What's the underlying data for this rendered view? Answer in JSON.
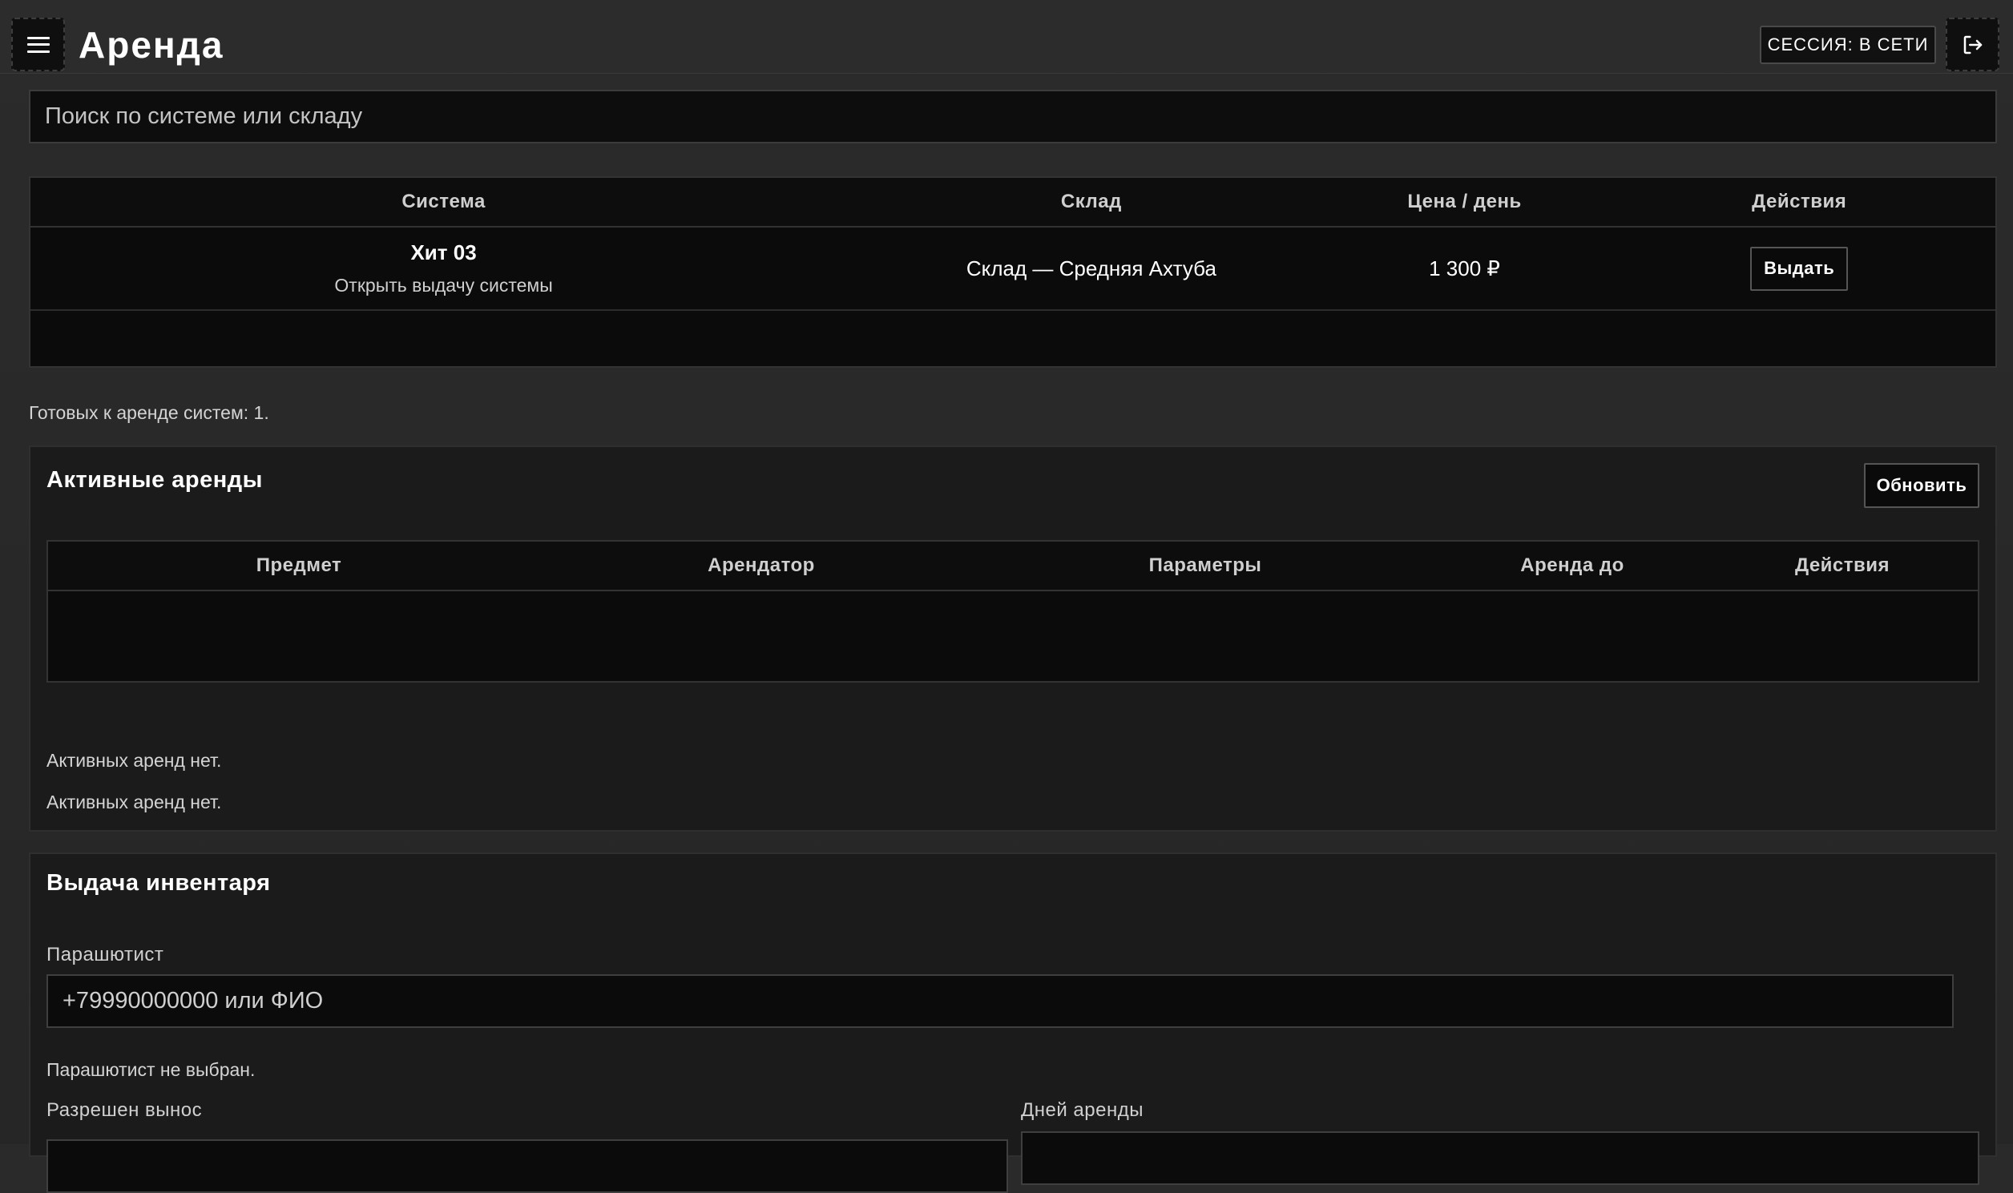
{
  "header": {
    "title": "Аренда",
    "session_label": "СЕССИЯ: В СЕТИ",
    "menu_icon": "hamburger-menu-icon",
    "logout_icon": "logout-icon"
  },
  "search": {
    "placeholder": "Поиск по системе или складу"
  },
  "systems_table": {
    "columns": [
      "Система",
      "Склад",
      "Цена / день",
      "Действия"
    ],
    "rows": [
      {
        "system_name": "Хит 03",
        "system_sub": "Открыть выдачу системы",
        "warehouse": "Склад — Средняя Ахтуба",
        "price": "1 300 ₽",
        "action_label": "Выдать"
      }
    ]
  },
  "ready_note": "Готовых к аренде систем: 1.",
  "active_rentals": {
    "title": "Активные аренды",
    "refresh_label": "Обновить",
    "columns": [
      "Предмет",
      "Арендатор",
      "Параметры",
      "Аренда до",
      "Действия"
    ],
    "empty_note_1": "Активных аренд нет.",
    "empty_note_2": "Активных аренд нет."
  },
  "issue_inventory": {
    "title": "Выдача инвентаря",
    "parachutist_label": "Парашютист",
    "parachutist_placeholder": "+79990000000 или ФИО",
    "parachutist_status": "Парашютист не выбран.",
    "carry_out_label": "Разрешен вынос",
    "days_label": "Дней аренды"
  },
  "colors": {
    "background": "#2a2a2a",
    "surface": "#0b0b0b",
    "panel": "#1b1b1b",
    "border": "#3b3b3b",
    "text": "#ffffff"
  }
}
